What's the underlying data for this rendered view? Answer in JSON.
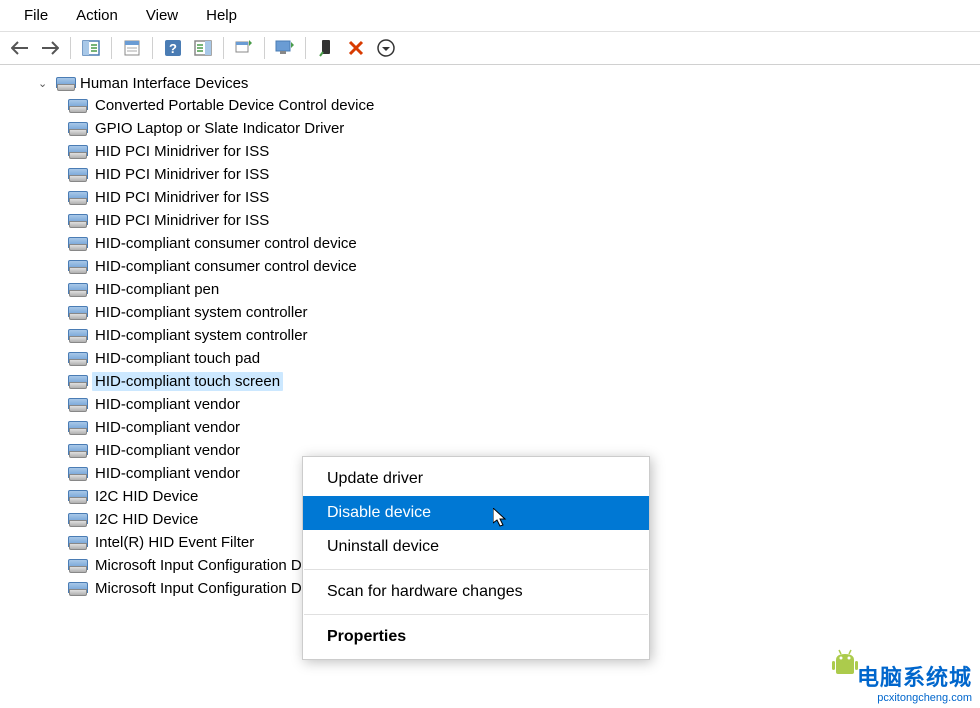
{
  "menubar": {
    "file": "File",
    "action": "Action",
    "view": "View",
    "help": "Help"
  },
  "tree": {
    "category_label": "Human Interface Devices",
    "items": [
      {
        "label": "Converted Portable Device Control device"
      },
      {
        "label": "GPIO Laptop or Slate Indicator Driver"
      },
      {
        "label": "HID PCI Minidriver for ISS"
      },
      {
        "label": "HID PCI Minidriver for ISS"
      },
      {
        "label": "HID PCI Minidriver for ISS"
      },
      {
        "label": "HID PCI Minidriver for ISS"
      },
      {
        "label": "HID-compliant consumer control device"
      },
      {
        "label": "HID-compliant consumer control device"
      },
      {
        "label": "HID-compliant pen"
      },
      {
        "label": "HID-compliant system controller"
      },
      {
        "label": "HID-compliant system controller"
      },
      {
        "label": "HID-compliant touch pad"
      },
      {
        "label": "HID-compliant touch screen",
        "selected": true
      },
      {
        "label": "HID-compliant vendor"
      },
      {
        "label": "HID-compliant vendor"
      },
      {
        "label": "HID-compliant vendor"
      },
      {
        "label": "HID-compliant vendor"
      },
      {
        "label": "I2C HID Device"
      },
      {
        "label": "I2C HID Device"
      },
      {
        "label": "Intel(R) HID Event Filter"
      },
      {
        "label": "Microsoft Input Configuration Device"
      },
      {
        "label": "Microsoft Input Configuration Device"
      }
    ]
  },
  "context_menu": {
    "update": "Update driver",
    "disable": "Disable device",
    "uninstall": "Uninstall device",
    "scan": "Scan for hardware changes",
    "properties": "Properties"
  },
  "watermark": {
    "main": "电脑系统城",
    "sub": "pcxitongcheng.com"
  }
}
